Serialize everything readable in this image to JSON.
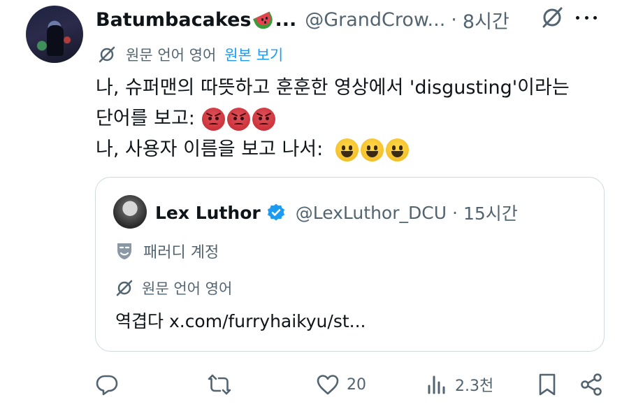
{
  "author": {
    "display_name": "Batumbacakes",
    "ellipsis": "...",
    "handle": "@GrandCrow...",
    "separator": "·",
    "time": "8시간",
    "emoji": "watermelon"
  },
  "translate": {
    "label": "원문 언어 영어",
    "link": "원본 보기"
  },
  "tweet": {
    "line1": "나, 슈퍼맨의 따뜻하고 훈훈한 영상에서 'disgusting'이라는",
    "line2": "단어를 보고:",
    "line3": "나, 사용자 이름을 보고 나서:",
    "line2_emojis": [
      "angry-face",
      "angry-face",
      "angry-face"
    ],
    "line3_emojis": [
      "grinning-face",
      "grinning-face",
      "grinning-face"
    ]
  },
  "quote": {
    "display_name": "Lex Luthor",
    "handle": "@LexLuthor_DCU",
    "separator": "·",
    "time": "15시간",
    "parody_label": "패러디 계정",
    "translate_label": "원문 언어 영어",
    "text": "역겹다 x.com/furryhaikyu/st..."
  },
  "actions": {
    "reply": {
      "icon": "reply-icon",
      "count": ""
    },
    "repost": {
      "icon": "repost-icon",
      "count": ""
    },
    "like": {
      "icon": "heart-icon",
      "count": "20"
    },
    "views": {
      "icon": "views-icon",
      "count": "2.3천"
    },
    "bookmark": {
      "icon": "bookmark-icon"
    },
    "share": {
      "icon": "share-icon"
    }
  },
  "colors": {
    "text": "#0f1419",
    "secondary": "#536471",
    "link": "#1d9bf0",
    "border": "#cfd9de"
  }
}
